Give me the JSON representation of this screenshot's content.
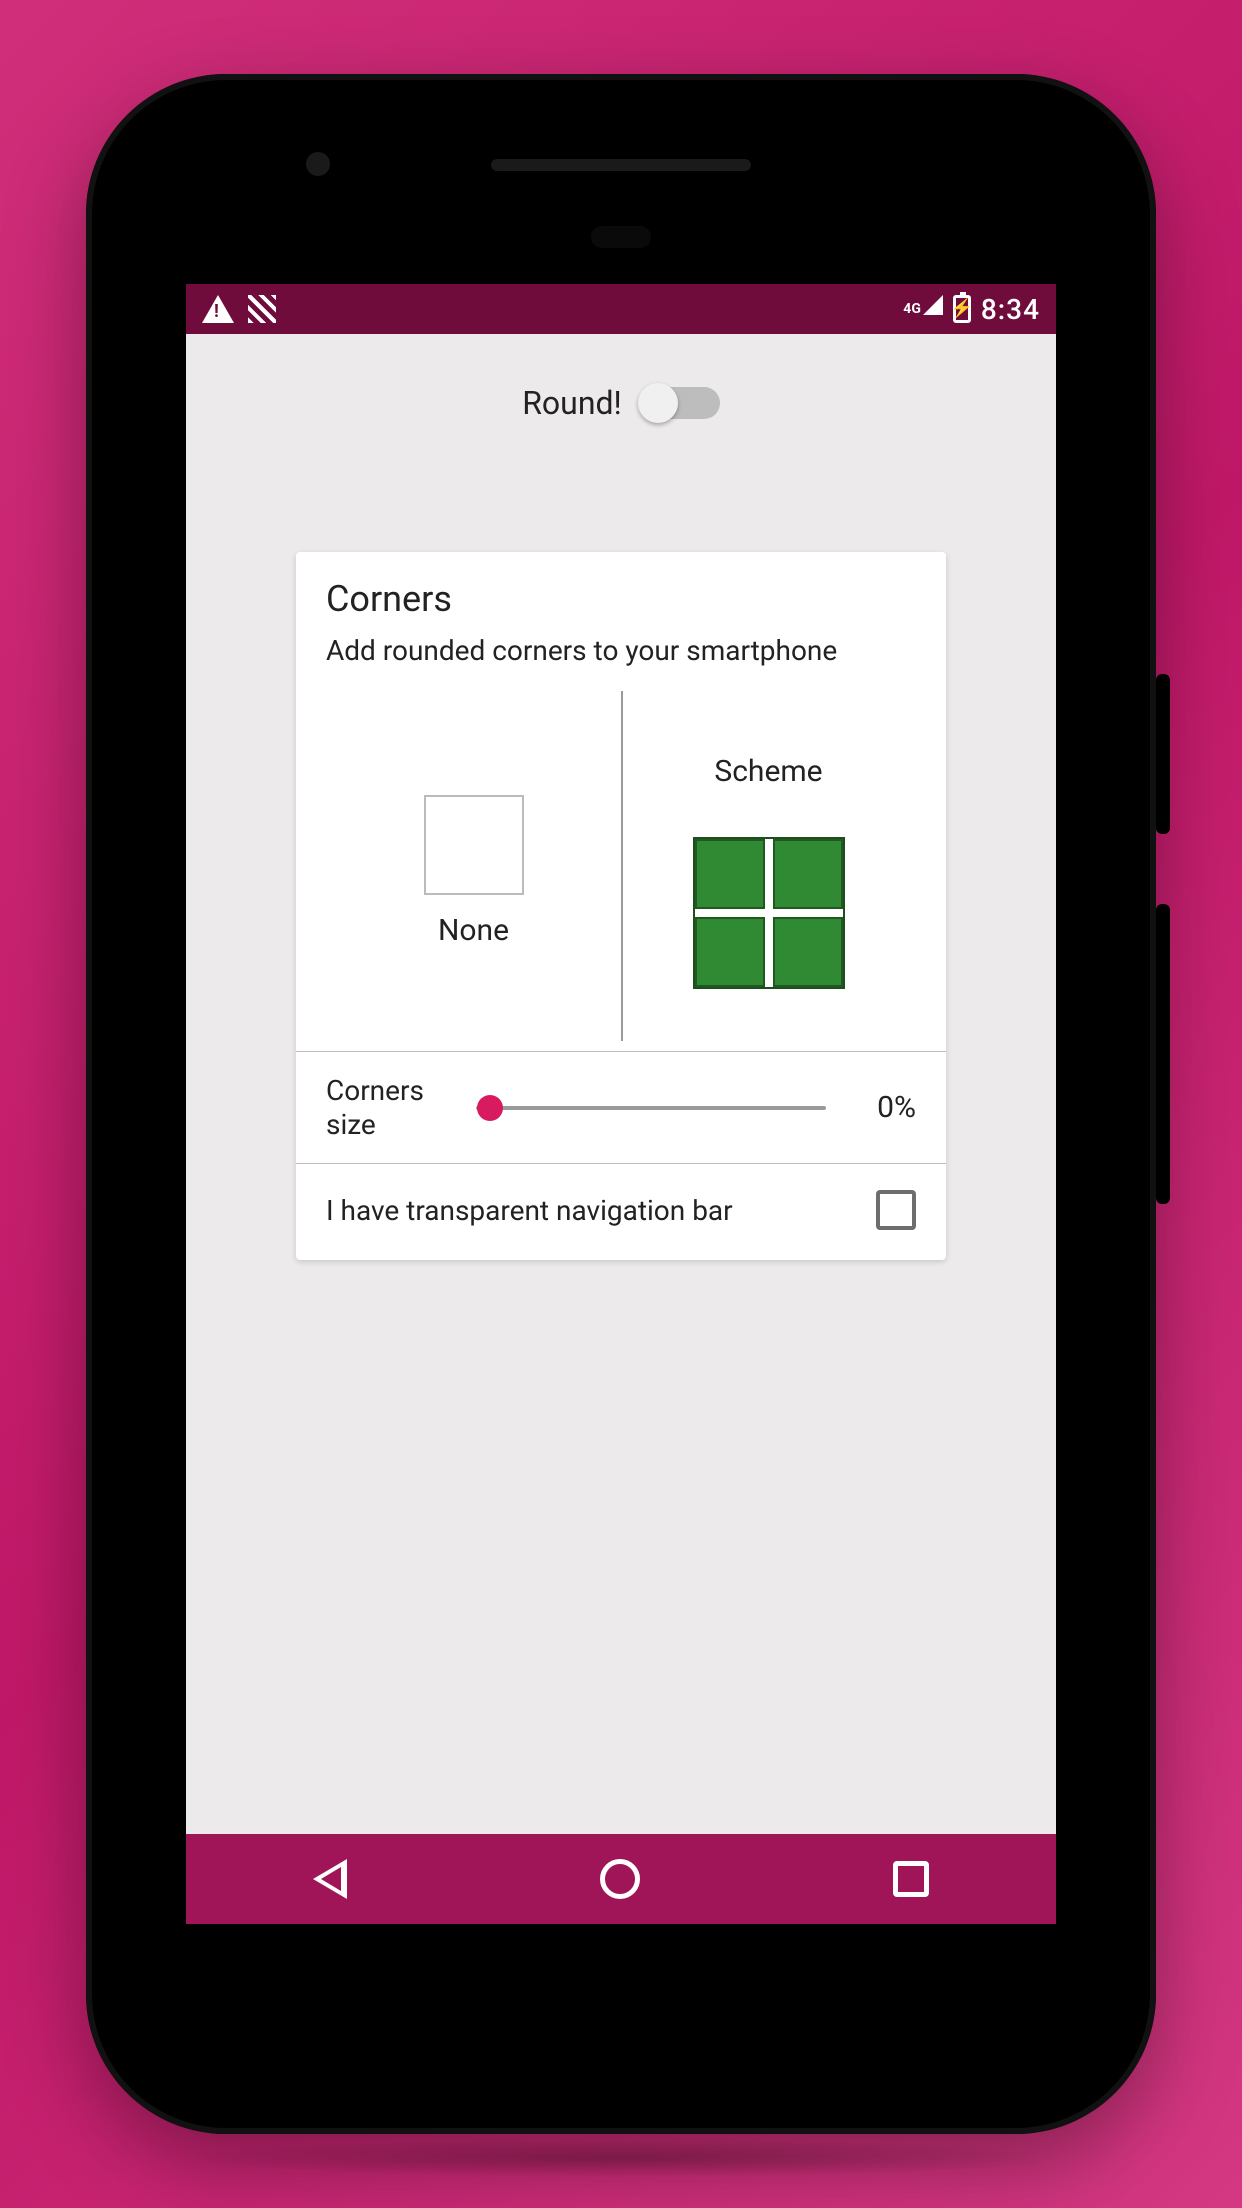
{
  "status": {
    "network": "4G",
    "time": "8:34"
  },
  "header": {
    "round_label": "Round!",
    "round_enabled": false
  },
  "card": {
    "title": "Corners",
    "subtitle": "Add rounded corners to your smartphone",
    "option_none": "None",
    "option_scheme": "Scheme",
    "slider_label": "Corners size",
    "slider_percent": 0,
    "slider_value_text": "0%",
    "transparent_nav_label": "I have transparent navigation bar",
    "transparent_nav_checked": false
  },
  "colors": {
    "accent": "#d81b60",
    "status_bar": "#6f0c3c",
    "nav_bar": "#a01458",
    "scheme_square": "#2f8a33"
  }
}
